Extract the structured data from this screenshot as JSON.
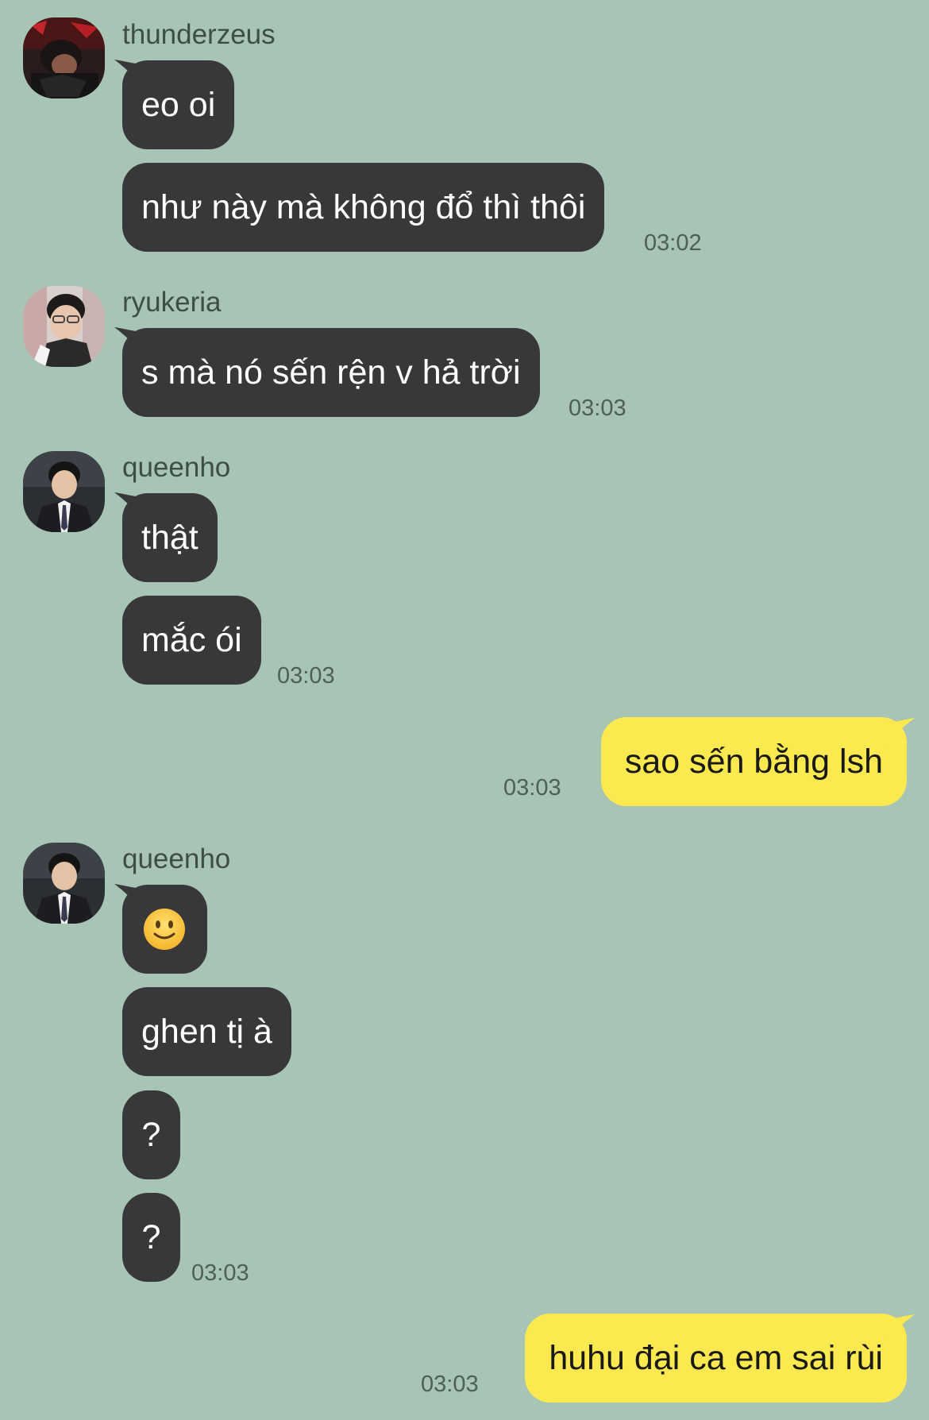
{
  "colors": {
    "background": "#a7c4b5",
    "incoming_bubble": "#38383b",
    "outgoing_bubble": "#fbe94f"
  },
  "messages": {
    "g1": {
      "sender": "thunderzeus",
      "avatar_icon": "profile-photo-icon",
      "m1": "eo oi",
      "m2": "như này mà không đổ thì thôi",
      "time": "03:02"
    },
    "g2": {
      "sender": "ryukeria",
      "avatar_icon": "profile-photo-icon",
      "m1": "s mà nó sến rện v hả trời",
      "time": "03:03"
    },
    "g3": {
      "sender": "queenho",
      "avatar_icon": "profile-photo-icon",
      "m1": "thật",
      "m2": "mắc ói",
      "time": "03:03"
    },
    "o1": {
      "text": "sao sến bằng lsh",
      "time": "03:03"
    },
    "g4": {
      "sender": "queenho",
      "avatar_icon": "profile-photo-icon",
      "emoji_icon": "slightly-smiling-face-icon",
      "m2": "ghen tị à",
      "m3": "?",
      "m4": "?",
      "time": "03:03"
    },
    "o2": {
      "text": "huhu đại ca em sai rùi",
      "time": "03:03"
    }
  }
}
